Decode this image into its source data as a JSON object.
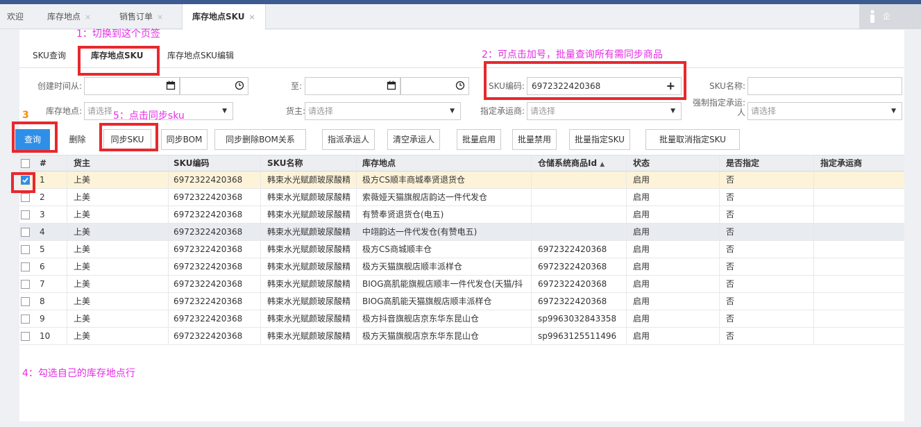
{
  "page_tabs": [
    {
      "label": "欢迎",
      "closable": false
    },
    {
      "label": "库存地点",
      "closable": true
    },
    {
      "label": "销售订单",
      "closable": true
    },
    {
      "label": "库存地点SKU",
      "closable": true,
      "active": true
    }
  ],
  "close_glyph": "×",
  "user_label": "企",
  "sub_tabs": [
    "SKU查询",
    "库存地点SKU",
    "库存地点SKU编辑"
  ],
  "filters": {
    "created_from_label": "创建时间从:",
    "to_label": "至:",
    "sku_code_label": "SKU编码:",
    "sku_code_value": "6972322420368",
    "sku_name_label": "SKU名称:",
    "location_label": "库存地点:",
    "location_placeholder": "请选择",
    "owner_label": "货主:",
    "owner_placeholder": "请选择",
    "carrier_label": "指定承运商:",
    "carrier_placeholder": "请选择",
    "forced_carrier_label_line1": "强制指定承运:",
    "forced_carrier_label_line2": "人",
    "forced_carrier_placeholder": "请选择"
  },
  "buttons": [
    "查询",
    "删除",
    "同步SKU",
    "同步BOM",
    "同步删除BOM关系",
    "指派承运人",
    "清空承运人",
    "批量启用",
    "批量禁用",
    "批量指定SKU",
    "批量取消指定SKU"
  ],
  "table": {
    "columns": [
      "#",
      "货主",
      "SKU编码",
      "SKU名称",
      "库存地点",
      "仓储系统商品Id",
      "状态",
      "是否指定",
      "指定承运商"
    ],
    "sort_indicator": "▲",
    "rows": [
      {
        "n": "1",
        "owner": "上美",
        "sku": "6972322420368",
        "name": "韩束水光赋颜玻尿酸精",
        "loc": "极方CS顺丰商城奉贤退货仓",
        "wms": "",
        "status": "启用",
        "assigned": "否",
        "carrier": "",
        "checked": true
      },
      {
        "n": "2",
        "owner": "上美",
        "sku": "6972322420368",
        "name": "韩束水光赋颜玻尿酸精",
        "loc": "索薇娅天猫旗舰店韵达一件代发仓",
        "wms": "",
        "status": "启用",
        "assigned": "否",
        "carrier": "",
        "checked": false
      },
      {
        "n": "3",
        "owner": "上美",
        "sku": "6972322420368",
        "name": "韩束水光赋颜玻尿酸精",
        "loc": "有赞奉贤退货仓(电五)",
        "wms": "",
        "status": "启用",
        "assigned": "否",
        "carrier": "",
        "checked": false
      },
      {
        "n": "4",
        "owner": "上美",
        "sku": "6972322420368",
        "name": "韩束水光赋颜玻尿酸精",
        "loc": "中翊韵达一件代发仓(有赞电五)",
        "wms": "",
        "status": "启用",
        "assigned": "否",
        "carrier": "",
        "checked": false
      },
      {
        "n": "5",
        "owner": "上美",
        "sku": "6972322420368",
        "name": "韩束水光赋颜玻尿酸精",
        "loc": "极方CS商城顺丰仓",
        "wms": "6972322420368",
        "status": "启用",
        "assigned": "否",
        "carrier": "",
        "checked": false
      },
      {
        "n": "6",
        "owner": "上美",
        "sku": "6972322420368",
        "name": "韩束水光赋颜玻尿酸精",
        "loc": "极方天猫旗舰店顺丰派样仓",
        "wms": "6972322420368",
        "status": "启用",
        "assigned": "否",
        "carrier": "",
        "checked": false
      },
      {
        "n": "7",
        "owner": "上美",
        "sku": "6972322420368",
        "name": "韩束水光赋颜玻尿酸精",
        "loc": "BIOG高肌能旗舰店顺丰一件代发仓(天猫/抖",
        "wms": "6972322420368",
        "status": "启用",
        "assigned": "否",
        "carrier": "",
        "checked": false
      },
      {
        "n": "8",
        "owner": "上美",
        "sku": "6972322420368",
        "name": "韩束水光赋颜玻尿酸精",
        "loc": "BIOG高肌能天猫旗舰店顺丰派样仓",
        "wms": "6972322420368",
        "status": "启用",
        "assigned": "否",
        "carrier": "",
        "checked": false
      },
      {
        "n": "9",
        "owner": "上美",
        "sku": "6972322420368",
        "name": "韩束水光赋颜玻尿酸精",
        "loc": "极方抖音旗舰店京东华东昆山仓",
        "wms": "sp9963032843358",
        "status": "启用",
        "assigned": "否",
        "carrier": "",
        "checked": false
      },
      {
        "n": "10",
        "owner": "上美",
        "sku": "6972322420368",
        "name": "韩束水光赋颜玻尿酸精",
        "loc": "极方天猫旗舰店京东华东昆山仓",
        "wms": "sp9963125511496",
        "status": "启用",
        "assigned": "否",
        "carrier": "",
        "checked": false
      }
    ]
  },
  "annotations": {
    "a1": "1：切换到这个页签",
    "a2": "2：可点击加号，批量查询所有需同步商品",
    "a3": "3",
    "a4": "4：勾选自己的库存地点行",
    "a5": "5：点击同步sku"
  },
  "icons": {
    "calendar": "calendar-icon",
    "clock": "clock-icon",
    "plus": "plus-icon",
    "user": "user-icon",
    "check": "check-icon"
  },
  "colors": {
    "primary": "#2f8fe8",
    "highlight_border": "#e8282d",
    "annotation_text": "#e62de6",
    "selected_row": "#fdf3d8",
    "topbar": "#3d5a91"
  }
}
